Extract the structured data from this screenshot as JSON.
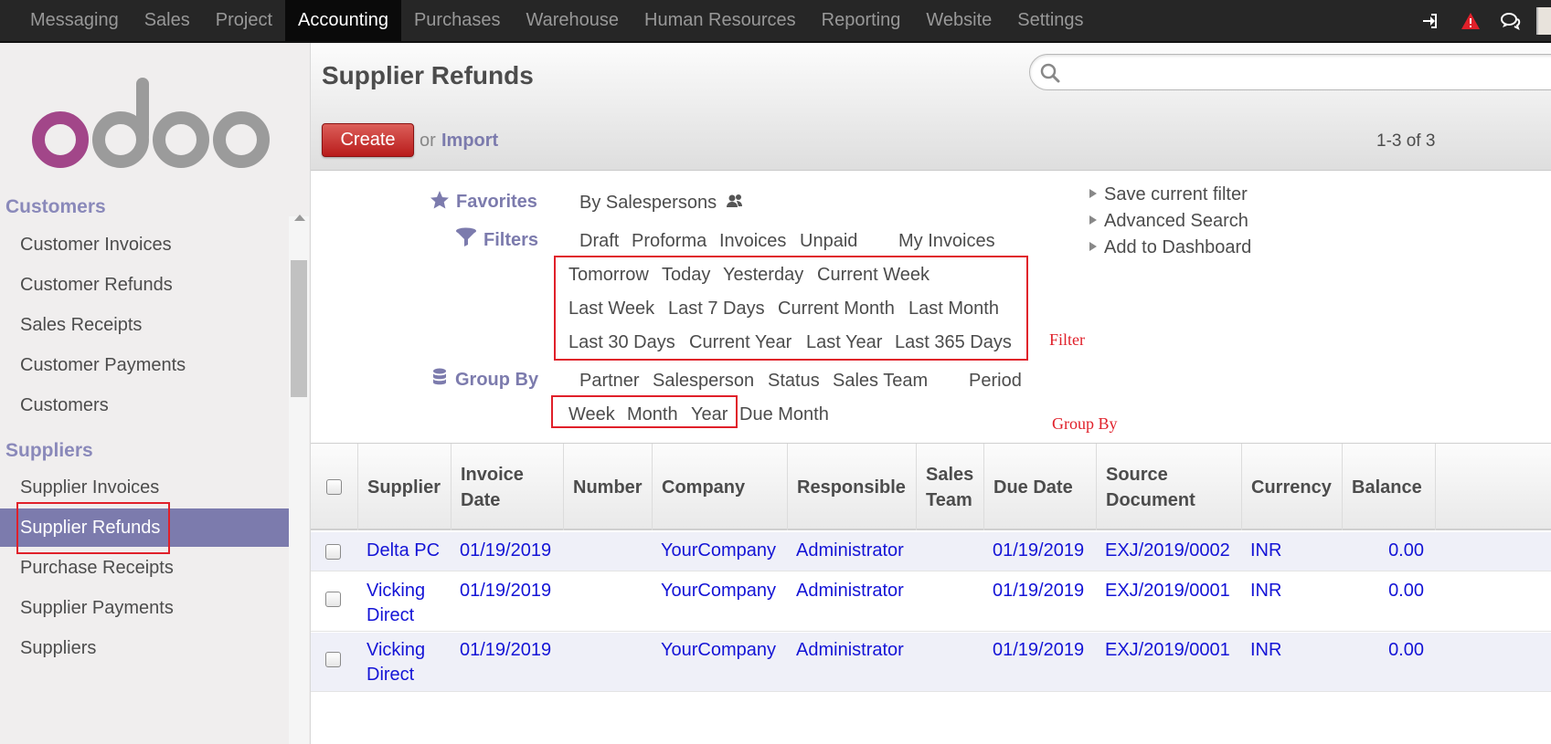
{
  "topbar": {
    "menu": [
      "Messaging",
      "Sales",
      "Project",
      "Accounting",
      "Purchases",
      "Warehouse",
      "Human Resources",
      "Reporting",
      "Website",
      "Settings"
    ],
    "active": "Accounting",
    "icons": [
      "sign-in-icon",
      "warning-icon",
      "chat-icon",
      "user-avatar"
    ]
  },
  "sidebar": {
    "logo_text": "odoo",
    "customers": {
      "title": "Customers",
      "items": [
        "Customer Invoices",
        "Customer Refunds",
        "Sales Receipts",
        "Customer Payments",
        "Customers"
      ]
    },
    "suppliers": {
      "title": "Suppliers",
      "items": [
        "Supplier Invoices",
        "Supplier Refunds",
        "Purchase Receipts",
        "Supplier Payments",
        "Suppliers"
      ],
      "active": "Supplier Refunds"
    }
  },
  "header": {
    "title": "Supplier Refunds",
    "create_label": "Create",
    "or_label": "or",
    "import_label": "Import",
    "pager": "1-3 of 3",
    "search_placeholder": ""
  },
  "drawer": {
    "favorites_label": "Favorites",
    "favorites": [
      "By Salespersons"
    ],
    "filters_label": "Filters",
    "filters_row1": [
      "Draft",
      "Proforma",
      "Invoices",
      "Unpaid",
      "My Invoices"
    ],
    "filters_date_row1": [
      "Tomorrow",
      "Today",
      "Yesterday",
      "Current Week"
    ],
    "filters_date_row2": [
      "Last Week",
      "Last 7 Days",
      "Current Month",
      "Last Month"
    ],
    "filters_date_row3": [
      "Last 30 Days",
      "Current Year",
      "Last Year",
      "Last 365 Days"
    ],
    "groupby_label": "Group By",
    "groupby_row1": [
      "Partner",
      "Salesperson",
      "Status",
      "Sales Team",
      "Period"
    ],
    "groupby_row2": [
      "Week",
      "Month",
      "Year",
      "Due Month"
    ],
    "side_links": [
      "Save current filter",
      "Advanced Search",
      "Add to Dashboard"
    ],
    "annotation_filter": "Filter",
    "annotation_groupby": "Group By"
  },
  "table": {
    "columns": [
      "Supplier",
      "Invoice Date",
      "Number",
      "Company",
      "Responsible",
      "Sales Team",
      "Due Date",
      "Source Document",
      "Currency",
      "Balance"
    ],
    "rows": [
      {
        "supplier": "Delta PC",
        "invoice_date": "01/19/2019",
        "number": "",
        "company": "YourCompany",
        "responsible": "Administrator",
        "sales_team": "",
        "due_date": "01/19/2019",
        "source": "EXJ/2019/0002",
        "currency": "INR",
        "balance": "0.00"
      },
      {
        "supplier": "Vicking Direct",
        "invoice_date": "01/19/2019",
        "number": "",
        "company": "YourCompany",
        "responsible": "Administrator",
        "sales_team": "",
        "due_date": "01/19/2019",
        "source": "EXJ/2019/0001",
        "currency": "INR",
        "balance": "0.00"
      },
      {
        "supplier": "Vicking Direct",
        "invoice_date": "01/19/2019",
        "number": "",
        "company": "YourCompany",
        "responsible": "Administrator",
        "sales_team": "",
        "due_date": "01/19/2019",
        "source": "EXJ/2019/0001",
        "currency": "INR",
        "balance": "0.00"
      }
    ]
  },
  "colors": {
    "topbar": "#262626",
    "accent": "#7c7bad",
    "create": "#c0262a",
    "annotation": "#e0202a",
    "link": "#1414d6"
  }
}
